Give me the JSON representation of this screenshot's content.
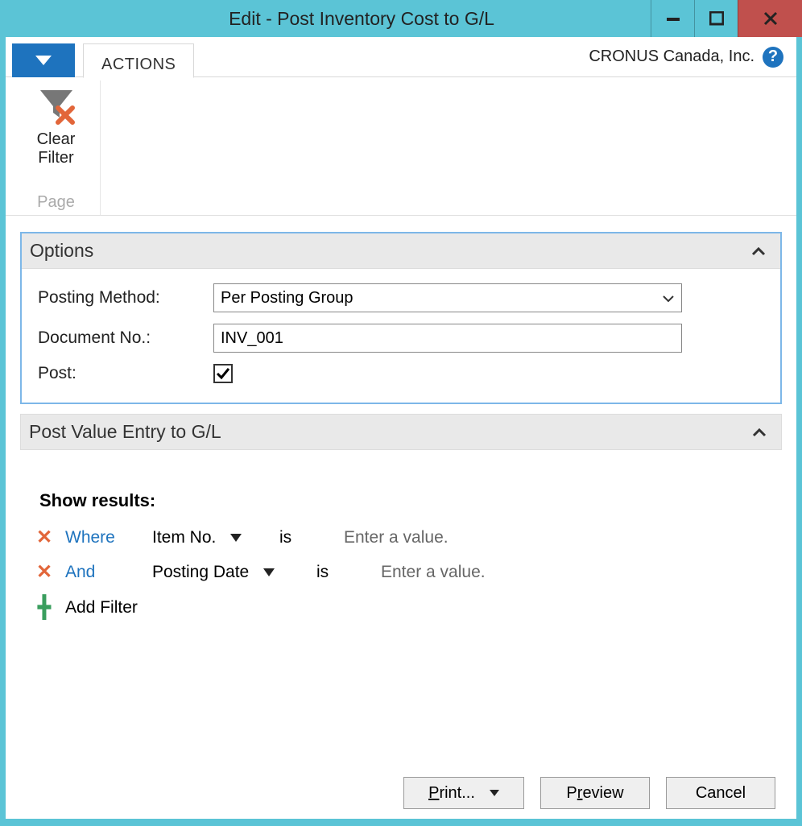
{
  "titlebar": {
    "title": "Edit - Post Inventory Cost to G/L"
  },
  "ribbon": {
    "tab_actions": "ACTIONS",
    "company": "CRONUS Canada, Inc.",
    "clear_filter_line1": "Clear",
    "clear_filter_line2": "Filter",
    "group_page": "Page"
  },
  "options": {
    "header": "Options",
    "posting_method_label": "Posting Method:",
    "posting_method_value": "Per Posting Group",
    "document_no_label": "Document No.:",
    "document_no_value": "INV_001",
    "post_label": "Post:",
    "post_checked": true
  },
  "postvalue": {
    "header": "Post Value Entry to G/L",
    "show_results": "Show results:",
    "rows": [
      {
        "keyword": "Where",
        "field": "Item No.",
        "is": "is",
        "placeholder": "Enter a value."
      },
      {
        "keyword": "And",
        "field": "Posting Date",
        "is": "is",
        "placeholder": "Enter a value."
      }
    ],
    "add_filter": "Add Filter"
  },
  "footer": {
    "print": "Print...",
    "preview": "Preview",
    "cancel": "Cancel"
  }
}
